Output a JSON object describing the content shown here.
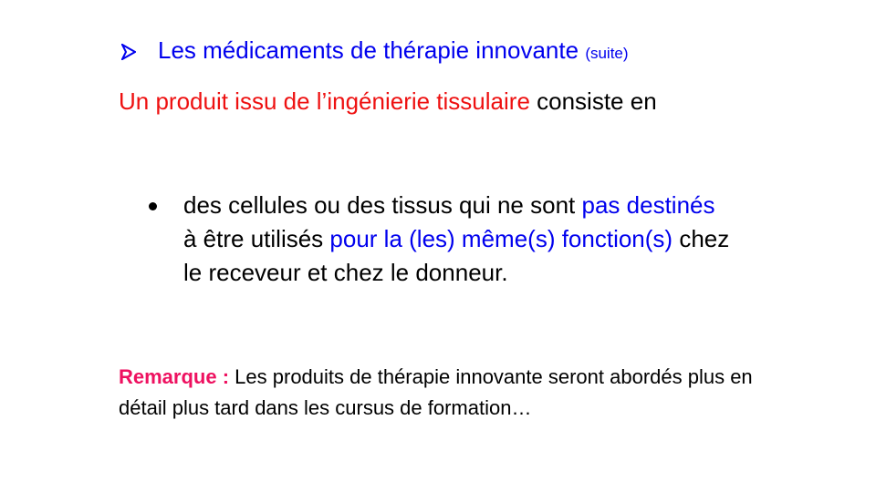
{
  "colors": {
    "blue": "#0000ee",
    "red": "#ee1111",
    "magenta": "#ee1160",
    "text": "#000000",
    "background": "#ffffff"
  },
  "heading": {
    "icon": "arrowhead-bullet-icon",
    "text": "Les médicaments de thérapie innovante",
    "suffix": "(suite)"
  },
  "intro": {
    "highlight": "Un produit issu de l’ingénierie tissulaire",
    "rest": "consiste en"
  },
  "bullet": {
    "icon": "round-bullet-icon",
    "part1": "des cellules ou des tissus qui ne sont",
    "part2_highlight": "pas destinés",
    "part3": "à être utilisés",
    "part4_highlight": "pour la (les) même(s) fonction(s)",
    "part5": "chez le receveur et chez le donneur."
  },
  "remark": {
    "label": "Remarque :",
    "text": "Les produits de thérapie innovante seront abordés plus en détail plus tard dans les cursus de formation…"
  }
}
